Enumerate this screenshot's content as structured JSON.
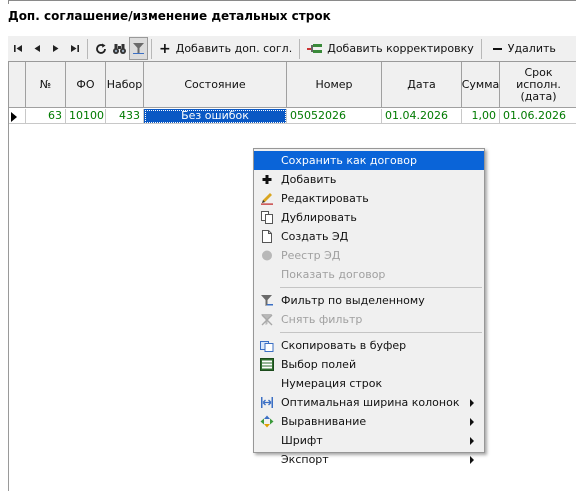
{
  "panel": {
    "title": "Доп. соглашение/изменение детальных строк"
  },
  "toolbar": {
    "add_agreement": "Добавить доп. согл.",
    "add_correction": "Добавить корректировку",
    "delete": "Удалить"
  },
  "table": {
    "columns": [
      "№",
      "ФО",
      "Набор",
      "Состояние",
      "Номер",
      "Дата",
      "Сумма",
      "Срок исполн. (дата)"
    ],
    "rows": [
      {
        "num": "63",
        "fo": "10100",
        "set": "433",
        "state": "Без ошибок",
        "number": "05052026",
        "date": "01.04.2026",
        "sum": "1,00",
        "due": "01.06.2026"
      }
    ]
  },
  "context_menu": {
    "items": [
      {
        "label": "Сохранить как договор",
        "icon": "",
        "state": "highlighted"
      },
      {
        "label": "Добавить",
        "icon": "plus-icon",
        "state": "enabled"
      },
      {
        "label": "Редактировать",
        "icon": "pencil-icon",
        "state": "enabled"
      },
      {
        "label": "Дублировать",
        "icon": "duplicate-icon",
        "state": "enabled"
      },
      {
        "label": "Создать ЭД",
        "icon": "document-icon",
        "state": "enabled"
      },
      {
        "label": "Реестр ЭД",
        "icon": "registry-icon",
        "state": "disabled"
      },
      {
        "label": "Показать договор",
        "icon": "",
        "state": "disabled"
      },
      {
        "label": "Фильтр по выделенному",
        "icon": "filter-icon",
        "state": "enabled"
      },
      {
        "label": "Снять фильтр",
        "icon": "clear-filter-icon",
        "state": "disabled"
      },
      {
        "label": "Скопировать в буфер",
        "icon": "copy-icon",
        "state": "enabled"
      },
      {
        "label": "Выбор полей",
        "icon": "fields-icon",
        "state": "enabled"
      },
      {
        "label": "Нумерация строк",
        "icon": "",
        "state": "enabled"
      },
      {
        "label": "Оптимальная ширина колонок",
        "icon": "column-width-icon",
        "state": "enabled",
        "submenu": true
      },
      {
        "label": "Выравнивание",
        "icon": "align-icon",
        "state": "enabled",
        "submenu": true
      },
      {
        "label": "Шрифт",
        "icon": "",
        "state": "enabled",
        "submenu": true
      },
      {
        "label": "Экспорт",
        "icon": "",
        "state": "enabled",
        "submenu": true
      }
    ]
  },
  "colors": {
    "selection": "#0a58c4",
    "row_text": "#007a00",
    "menu_highlight": "#0a64d8"
  }
}
